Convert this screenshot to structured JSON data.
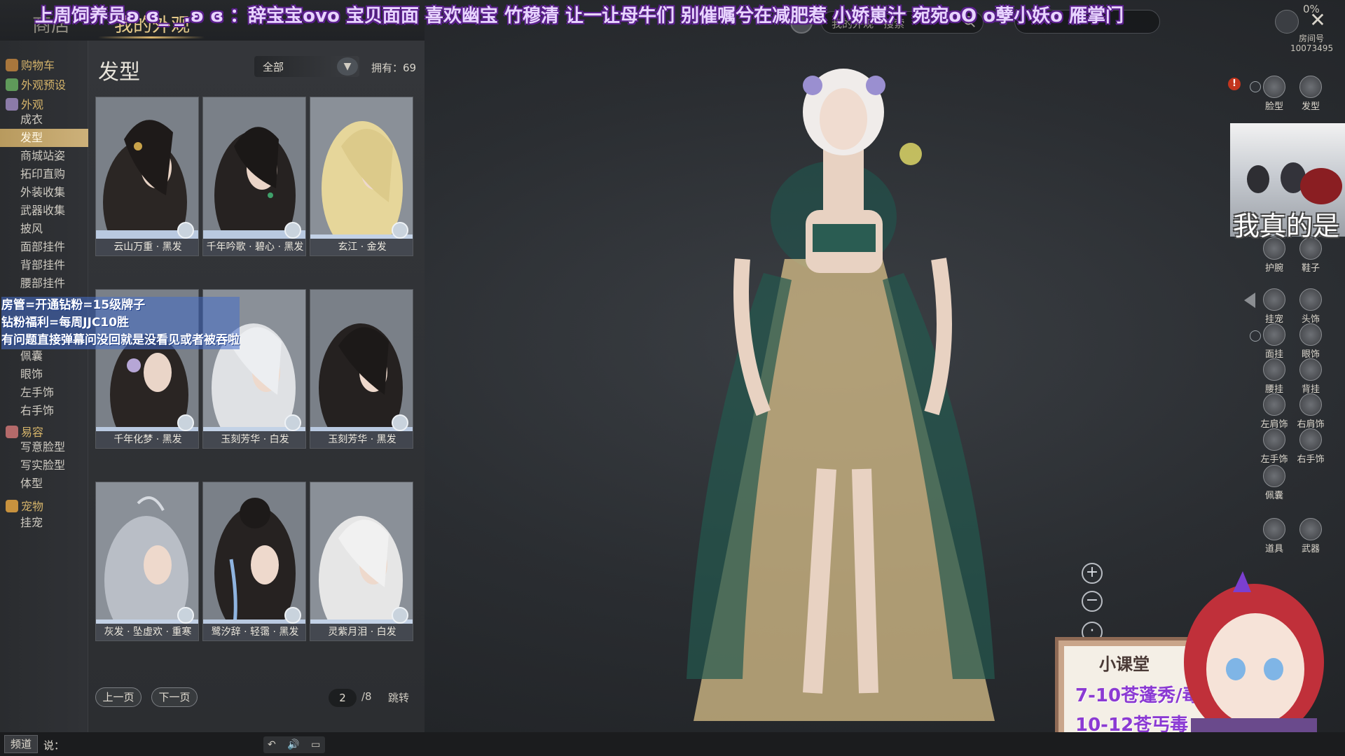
{
  "top_nav": {
    "tabs": [
      "商店",
      "我的外观"
    ],
    "active_tab": "我的外观"
  },
  "search": {
    "text": "我的外观 · 搜索"
  },
  "status": {
    "percent": "0%",
    "room_label": "房间号",
    "room_id": "10073495"
  },
  "danmaku": "上周饲养员ʚ ɞ_ _.ʚ ɞ ：辞宝宝ovo 宝贝面面 喜欢幽宝 竹穆清 让一让母牛们 别催嘱兮在减肥惹 小娇崽汁 宛宛oO o孽小妖o 雁掌门",
  "sidebar": {
    "categories": [
      {
        "label": "购物车",
        "children": []
      },
      {
        "label": "外观预设",
        "children": []
      },
      {
        "label": "外观",
        "children": [
          "成衣",
          "发型",
          "商城站姿",
          "拓印直购",
          "外装收集",
          "武器收集",
          "披风",
          "面部挂件",
          "背部挂件",
          "腰部挂件",
          "佩囊",
          "眼饰",
          "左手饰",
          "右手饰"
        ]
      },
      {
        "label": "易容",
        "children": [
          "写意脸型",
          "写实脸型",
          "体型"
        ]
      },
      {
        "label": "宠物",
        "children": [
          "挂宠"
        ]
      }
    ],
    "active_item": "发型"
  },
  "panel": {
    "title": "发型",
    "filter": {
      "selected": "全部"
    },
    "owned": "拥有：69",
    "items": [
      {
        "name": "云山万重 · 黑发"
      },
      {
        "name": "千年吟歌 · 碧心 · 黑发"
      },
      {
        "name": "玄江 · 金发"
      },
      {
        "name": "千年化梦 · 黑发"
      },
      {
        "name": "玉刻芳华 · 白发"
      },
      {
        "name": "玉刻芳华 · 黑发"
      },
      {
        "name": "灰发 · 坠虚欢 · 重寒"
      },
      {
        "name": "鹭汐辞 · 轻霭 · 黑发"
      },
      {
        "name": "灵紫月泪 · 白发"
      }
    ],
    "pager": {
      "prev": "上一页",
      "next": "下一页",
      "current": "2",
      "total": "/8",
      "jump": "跳转"
    }
  },
  "notes": [
    "房管=开通钻粉=15级牌子",
    "钻粉福利=每周JJC10胜",
    "有问题直接弹幕问没回就是没看见或者被吞啦"
  ],
  "equipment_slots": [
    "脸型",
    "发型",
    "护腕",
    "鞋子",
    "挂宠",
    "头饰",
    "面挂",
    "眼饰",
    "腰挂",
    "背挂",
    "左肩饰",
    "右肩饰",
    "左手饰",
    "右手饰",
    "佩囊",
    "道具",
    "武器"
  ],
  "stream": {
    "cam_caption": "我真的是",
    "board_title": "小课堂",
    "board_lines": [
      "7-10苍蓬秀/毒",
      "10-12苍丐毒"
    ]
  },
  "chat": {
    "channel": "频道",
    "say": "说：",
    "tools": "↶ 🔊 ▭ ☺"
  },
  "colors": {
    "accent_gold": "#d4b36a",
    "active_item_bg": "#c4a56c",
    "danmaku": "#e8d4ff"
  }
}
